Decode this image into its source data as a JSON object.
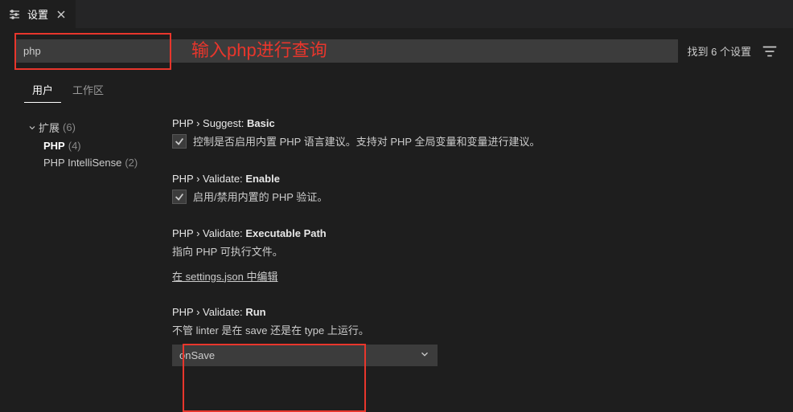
{
  "tab": {
    "label": "设置"
  },
  "search": {
    "value": "php",
    "results": "找到 6 个设置"
  },
  "annotations": {
    "search_hint": "输入php进行查询"
  },
  "scope": {
    "user": "用户",
    "workspace": "工作区"
  },
  "sidebar": {
    "root": {
      "label": "扩展",
      "count": "(6)"
    },
    "items": [
      {
        "label": "PHP",
        "count": "(4)"
      },
      {
        "label": "PHP IntelliSense",
        "count": "(2)"
      }
    ]
  },
  "settings": [
    {
      "category": "PHP › Suggest:",
      "name": "Basic",
      "type": "checkbox",
      "checked": true,
      "description": "控制是否启用内置 PHP 语言建议。支持对 PHP 全局变量和变量进行建议。"
    },
    {
      "category": "PHP › Validate:",
      "name": "Enable",
      "type": "checkbox",
      "checked": true,
      "description": "启用/禁用内置的 PHP 验证。"
    },
    {
      "category": "PHP › Validate:",
      "name": "Executable Path",
      "type": "link",
      "description": "指向 PHP 可执行文件。",
      "link_text": "在 settings.json 中编辑"
    },
    {
      "category": "PHP › Validate:",
      "name": "Run",
      "type": "select",
      "description": "不管 linter 是在 save 还是在 type 上运行。",
      "value": "onSave"
    }
  ]
}
